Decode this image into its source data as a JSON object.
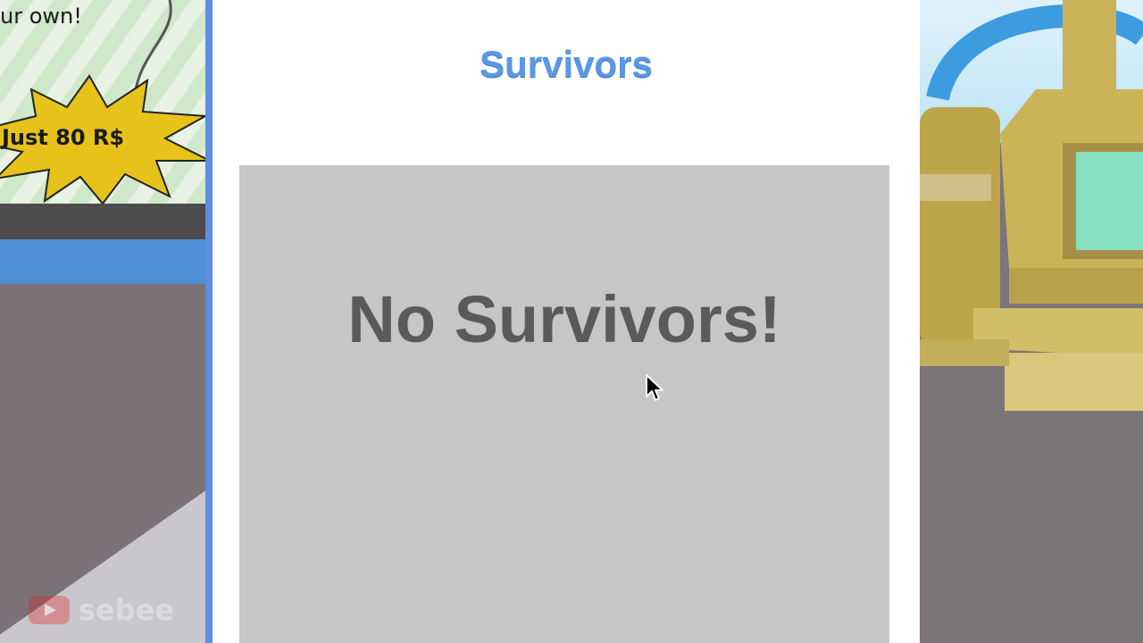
{
  "background": {
    "poster_caption": "ur own!",
    "price_burst": "Just 80 R$"
  },
  "panel": {
    "title": "Survivors",
    "empty_message": "No Survivors!"
  },
  "watermark": {
    "icon": "youtube-icon",
    "text": "sebee"
  },
  "colors": {
    "title": "#5a98e6",
    "panel_bg": "#ffffff",
    "list_bg": "#c6c6c6",
    "empty_text": "#5a5a5a",
    "accent_edge": "#5b8fe0"
  }
}
